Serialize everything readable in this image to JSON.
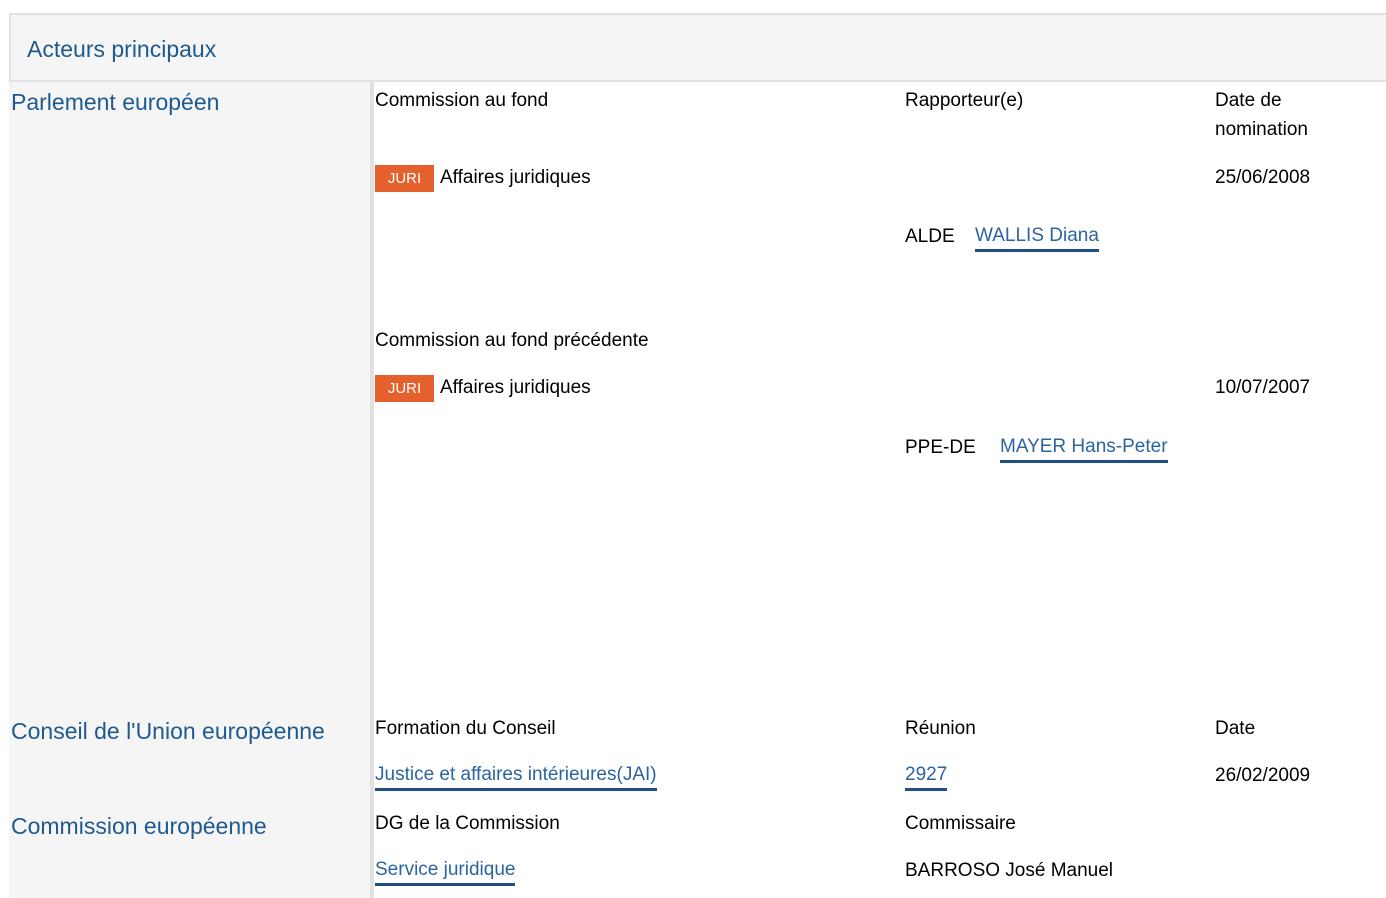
{
  "header": {
    "title": "Acteurs principaux"
  },
  "parliament": {
    "title": "Parlement européen",
    "col_committee": "Commission au fond",
    "col_rapporteur": "Rapporteur(e)",
    "col_date_line1": "Date de",
    "col_date_line2": "nomination",
    "current": {
      "badge": "JURI",
      "committee": "Affaires juridiques",
      "date": "25/06/2008",
      "group": "ALDE",
      "rapporteur": "WALLIS Diana"
    },
    "previous_label": "Commission au fond précédente",
    "previous": {
      "badge": "JURI",
      "committee": "Affaires juridiques",
      "date": "10/07/2007",
      "group": "PPE-DE",
      "rapporteur": "MAYER Hans-Peter"
    }
  },
  "council": {
    "title": "Conseil de l'Union européenne",
    "col_formation": "Formation du Conseil",
    "col_meeting": "Réunion",
    "col_date": "Date",
    "formation": "Justice et affaires intérieures(JAI)",
    "meeting": "2927",
    "date": "26/02/2009"
  },
  "commission": {
    "title": "Commission européenne",
    "col_dg": "DG de la Commission",
    "col_commissioner": "Commissaire",
    "dg": "Service juridique",
    "commissioner": "BARROSO José Manuel"
  }
}
